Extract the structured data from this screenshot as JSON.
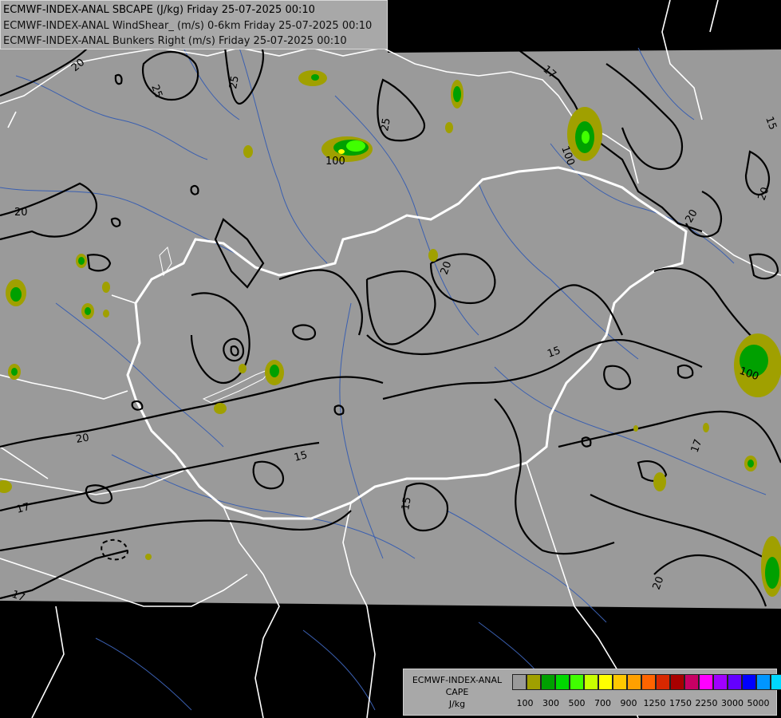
{
  "header": {
    "line1": "ECMWF-INDEX-ANAL SBCAPE (J/kg) Friday 25-07-2025 00:10",
    "line2": "ECMWF-INDEX-ANAL WindShear_ (m/s) 0-6km Friday 25-07-2025 00:10",
    "line3": "ECMWF-INDEX-ANAL Bunkers Right (m/s) Friday 25-07-2025 00:10"
  },
  "legend": {
    "title_line1": "ECMWF-INDEX-ANAL",
    "title_line2": "CAPE",
    "title_line3": "J/kg",
    "colors": [
      "#9a9a9a",
      "#a0a000",
      "#00a000",
      "#00d800",
      "#40ff00",
      "#c8ff00",
      "#ffff00",
      "#ffc800",
      "#ffa000",
      "#ff6400",
      "#d82800",
      "#a80000",
      "#c80064",
      "#ff00ff",
      "#a000ff",
      "#6400ff",
      "#0000ff",
      "#0096ff",
      "#00d8ff",
      "#80ffff",
      "#ffffff"
    ],
    "tick_labels": [
      "100",
      "300",
      "500",
      "700",
      "900",
      "1250",
      "1750",
      "2250",
      "3000",
      "5000"
    ]
  },
  "contour_labels": [
    "20",
    "25",
    "25",
    "25",
    "17",
    "15",
    "100",
    "100",
    "20",
    "20",
    "20",
    "20",
    "20",
    "15",
    "17",
    "15",
    "15",
    "17",
    "100",
    "20",
    "17"
  ],
  "palette": {
    "background": "#000000",
    "data_area": "#9a9a9a",
    "border_color": "#ffffff",
    "river_color": "#3a5fb0",
    "contour_color": "#000000"
  }
}
